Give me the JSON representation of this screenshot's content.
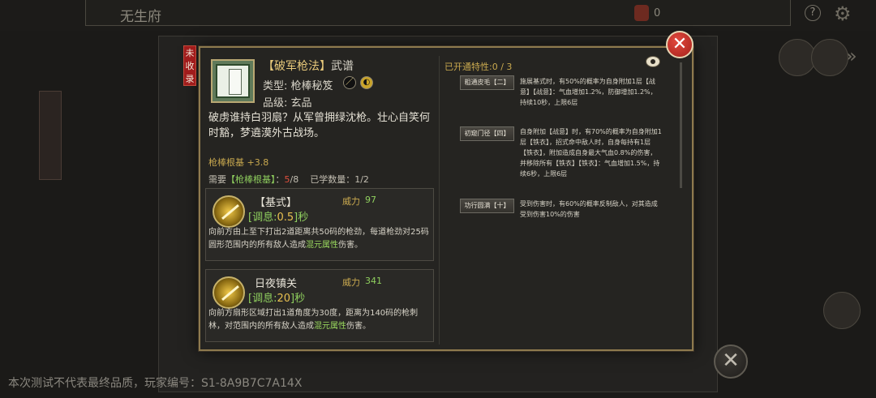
{
  "background": {
    "title": "无生府",
    "coin_count": "0",
    "help_label": "?",
    "watermark": "本次测试不代表最终品质，玩家编号：S1-8A9B7C7A14X"
  },
  "modal": {
    "badge": "未收录",
    "close_label": "✕",
    "book": {
      "title": "【破军枪法】",
      "title_suffix": "武谱",
      "type_label": "类型: 枪棒秘笈",
      "grade_label": "品级: 玄品",
      "poem": "破虏谁持白羽扇？从军曾拥绿沈枪。壮心自笑何时豁，梦遶漠外古战场。",
      "base_stat": "枪棒根基 +3.8",
      "req_prefix": "需要",
      "req_name": "【枪棒根基】",
      "req_sep": "：",
      "req_have": "5",
      "req_total": "/8",
      "learned_label": "已学数量：1/2"
    },
    "skills": [
      {
        "name": "【基式】",
        "power_label": "威力",
        "power": "97",
        "cd_prefix": "[调息:",
        "cd_value": "0.5",
        "cd_suffix": "]秒",
        "desc_main": "向前方由上至下打出2道距离共50码的枪劲，每道枪劲对25码圆形范围内的所有敌人造成",
        "desc_highlight": "混元属性",
        "desc_tail": "伤害。"
      },
      {
        "name": "日夜镇关",
        "power_label": "威力",
        "power": "341",
        "cd_prefix": "[调息:",
        "cd_value": "20",
        "cd_suffix": "]秒",
        "desc_main": "向前方扇形区域打出1道角度为30度，距离为140码的枪刺林，对范围内的所有敌人造成",
        "desc_highlight": "混元属性",
        "desc_tail": "伤害。"
      }
    ],
    "traits": {
      "header": "已开通特性:0 / 3",
      "items": [
        {
          "label": "粗通皮毛【二】",
          "desc": "施展基式时，有50%的概率为自身附加1层【战意】【战意】：气血增加1.2%，防御增加1.2%，持续10秒，上限6层"
        },
        {
          "label": "初窥门径【四】",
          "desc": "自身附加【战意】时，有70%的概率为自身附加1层【铁衣】，招式命中敌人时，自身每持有1层【铁衣】，附加造成自身最大气血0.8%的伤害，并移除所有【铁衣】【铁衣】：气血增加1.5%，持续6秒，上限6层"
        },
        {
          "label": "功行圆满【十】",
          "desc": "受到伤害时，有60%的概率反制敌人，对其造成受到伤害10%的伤害"
        }
      ]
    }
  }
}
